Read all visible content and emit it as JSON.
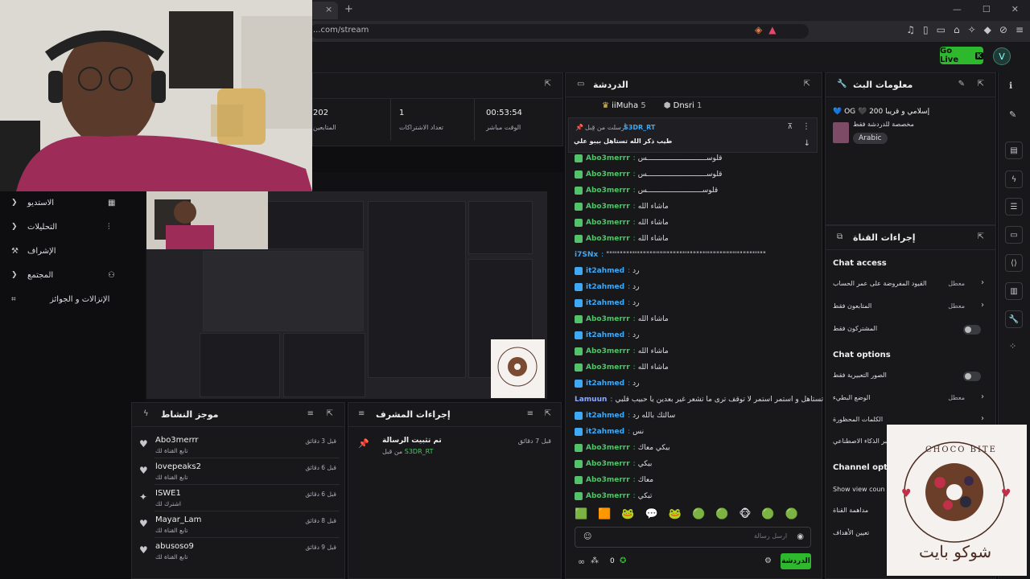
{
  "browser": {
    "url": "...com/stream",
    "tab_close": "×",
    "tab_add": "+",
    "window_controls": [
      "—",
      "☐",
      "✕"
    ]
  },
  "header": {
    "go_live_label": "Go Live",
    "go_live_icon": "K",
    "profile_initial": "V"
  },
  "sidebar": {
    "items": [
      {
        "label": "الاستديو",
        "icon": "studio-icon",
        "glyph": "▦",
        "has_chevron": true
      },
      {
        "label": "التحليلات",
        "icon": "analytics-icon",
        "glyph": "⫶",
        "has_chevron": true
      },
      {
        "label": "الإشراف",
        "icon": "moderation-icon",
        "glyph": "⚒",
        "has_chevron": false
      },
      {
        "label": "المجتمع",
        "icon": "community-icon",
        "glyph": "⚇",
        "has_chevron": true
      },
      {
        "label": "الإنزالات و الجوائز",
        "icon": "drops-icon",
        "glyph": "⌗",
        "has_chevron": false
      }
    ]
  },
  "stats": {
    "items": [
      {
        "value": "00:53:54",
        "label": "الوقت مباشر"
      },
      {
        "value": "1",
        "label": "تعداد الاشتراكات"
      },
      {
        "value": "202",
        "label": "المتابعين"
      }
    ]
  },
  "activity": {
    "title": "موجز النشاط",
    "items": [
      {
        "name": "Abo3merrr",
        "sub": "تابع القناة لك",
        "time": "قبل 3 دقائق",
        "icon": "heart"
      },
      {
        "name": "lovepeaks2",
        "sub": "تابع القناة لك",
        "time": "قبل 6 دقائق",
        "icon": "heart"
      },
      {
        "name": "ISWE1",
        "sub": "اشترك لك",
        "time": "قبل 6 دقائق",
        "icon": "sparkle"
      },
      {
        "name": "Mayar_Lam",
        "sub": "تابع القناة لك",
        "time": "قبل 8 دقائق",
        "icon": "heart"
      },
      {
        "name": "abusoso9",
        "sub": "تابع القناة لك",
        "time": "قبل 9 دقائق",
        "icon": "heart"
      }
    ]
  },
  "modactions": {
    "title": "إجراءات المشرف",
    "item": {
      "title": "تم تثبيت الرسالة",
      "by_prefix": "من قبل",
      "by": "S3DR_RT",
      "time": "قبل 7 دقائق"
    }
  },
  "chat": {
    "title": "الدردشة",
    "top_users": [
      {
        "name": "iiMuha",
        "count": "5"
      },
      {
        "name": "Dnsri",
        "count": "1"
      }
    ],
    "pinned": {
      "sender_prefix": "أرسلت من قِبل",
      "sender": "S3DR_RT",
      "text": "طيب ذكر الله تستاهل بيبو علي"
    },
    "messages": [
      {
        "name": "Abo3merrr",
        "color": "#53c26a",
        "text": "قلوســــــــــــــــــــــــــــس"
      },
      {
        "name": "Abo3merrr",
        "color": "#53c26a",
        "text": "قلوســــــــــــــــــــــــــــس"
      },
      {
        "name": "Abo3merrr",
        "color": "#53c26a",
        "text": "قلوســــــــــــــــــــــــــس"
      },
      {
        "name": "Abo3merrr",
        "color": "#53c26a",
        "text": "ماشاء الله"
      },
      {
        "name": "Abo3merrr",
        "color": "#53c26a",
        "text": "ماشاء الله"
      },
      {
        "name": "Abo3merrr",
        "color": "#53c26a",
        "text": "ماشاء الله"
      },
      {
        "name": "i7SNx",
        "color": "#3fa9f5",
        "text": "\"\"\"\"\"\"\"\"\"\"\"\"\"\"\"\"\"\"\"\"\"\"\"\"\"\"\"\"\"\"\"\"\"\"\"\"\"\"\"\"\"\"\"\"\"\"\"\""
      },
      {
        "name": "it2ahmed",
        "color": "#3fa9f5",
        "text": "رد"
      },
      {
        "name": "it2ahmed",
        "color": "#3fa9f5",
        "text": "رد"
      },
      {
        "name": "it2ahmed",
        "color": "#3fa9f5",
        "text": "رد"
      },
      {
        "name": "Abo3merrr",
        "color": "#53c26a",
        "text": "ماشاء الله"
      },
      {
        "name": "it2ahmed",
        "color": "#3fa9f5",
        "text": "رد"
      },
      {
        "name": "Abo3merrr",
        "color": "#53c26a",
        "text": "ماشاء الله"
      },
      {
        "name": "Abo3merrr",
        "color": "#53c26a",
        "text": "ماشاء الله"
      },
      {
        "name": "it2ahmed",
        "color": "#3fa9f5",
        "text": "رد"
      },
      {
        "name": "Lamuun",
        "color": "#8fa8ff",
        "text": "ياخي تستاهل و استمر استمر لا توقف ترى ما تشعر غير بعدين يا حبيب قلبي"
      },
      {
        "name": "it2ahmed",
        "color": "#3fa9f5",
        "text": "سالتك بالله رد"
      },
      {
        "name": "it2ahmed",
        "color": "#3fa9f5",
        "text": "نس"
      },
      {
        "name": "Abo3merrr",
        "color": "#53c26a",
        "text": "بيكي معاك"
      },
      {
        "name": "Abo3merrr",
        "color": "#53c26a",
        "text": "بيكي"
      },
      {
        "name": "Abo3merrr",
        "color": "#53c26a",
        "text": "معاك"
      },
      {
        "name": "Abo3merrr",
        "color": "#53c26a",
        "text": "تبكي"
      }
    ],
    "emotes": [
      "🟩",
      "🟧",
      "🐸",
      "💬",
      "🐸",
      "🟢",
      "🟢",
      "🐵",
      "🟢",
      "🟢"
    ],
    "input_placeholder": "ارسل رسالة",
    "footer_count": "0",
    "send_label": "الدردشة"
  },
  "info": {
    "title": "معلومات البث",
    "stream_title": "💙 OG 🖤 إسلامي و قريبا 200",
    "category": "مخصصة للدردشة فقط",
    "tag": "Arabic"
  },
  "channel_actions": {
    "title": "إجراءات القناة",
    "chat_access_head": "Chat access",
    "access_rows": [
      {
        "label": "القيود المفروضة على عمر الحساب",
        "value": "معطل",
        "type": "chevron"
      },
      {
        "label": "المتابعون فقط",
        "value": "معطل",
        "type": "chevron"
      },
      {
        "label": "المشتركون فقط",
        "value": "",
        "type": "toggle"
      }
    ],
    "chat_options_head": "Chat options",
    "option_rows": [
      {
        "label": "الصور التعبيرية فقط",
        "value": "",
        "type": "toggle"
      },
      {
        "label": "الوضع البطيء",
        "value": "معطل",
        "type": "chevron"
      },
      {
        "label": "الكلمات المحظورة",
        "value": "",
        "type": "chevron"
      },
      {
        "label": "عبر الذكاء الاصطناعي",
        "value": "",
        "type": "none"
      }
    ],
    "channel_options_head": "Channel optio",
    "channel_rows": [
      {
        "label": "Show view coun"
      },
      {
        "label": "مداهمة القناة"
      },
      {
        "label": "تعيين الأهداف"
      }
    ]
  },
  "rail_icons": [
    "pencil-icon",
    "layout-icon",
    "lightning-icon",
    "list-icon",
    "chat-icon",
    "code-icon",
    "stack-icon",
    "wrench-icon",
    "dots-icon"
  ],
  "choco": {
    "brand_en": "CHOCO BITE",
    "brand_ar": "شوكو بايت"
  },
  "colors": {
    "accent": "#2eb82e",
    "bg": "#0e0e10",
    "panel": "#18181b"
  }
}
